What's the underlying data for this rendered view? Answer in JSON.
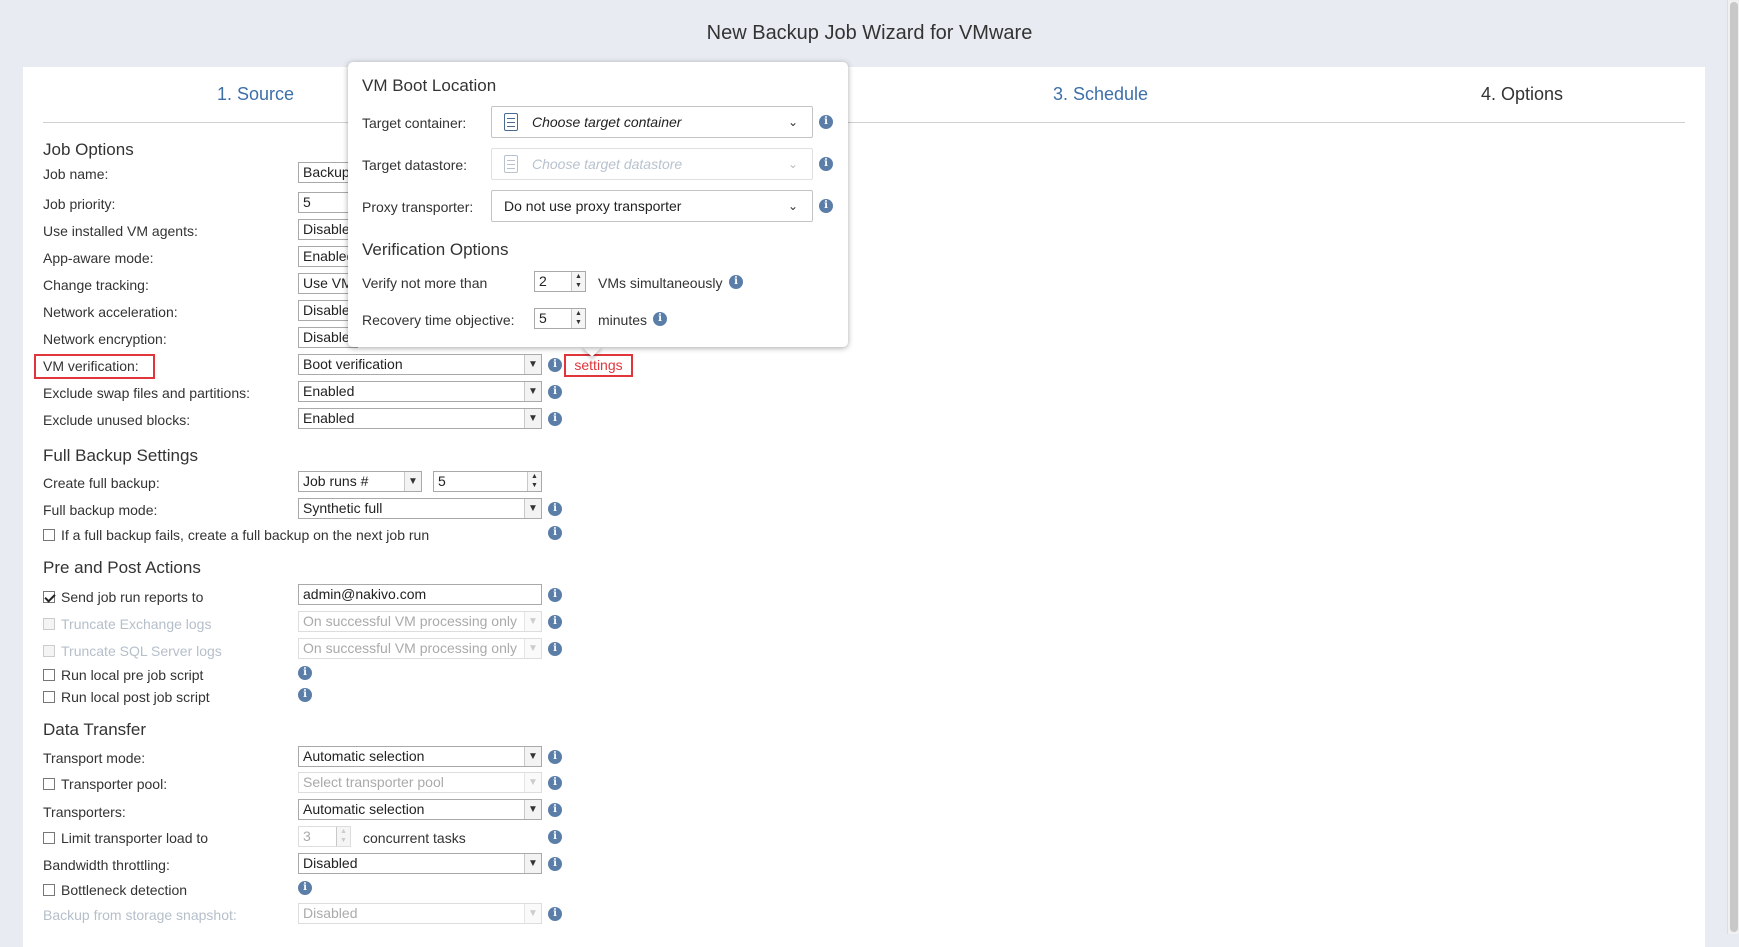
{
  "page_title": "New Backup Job Wizard for VMware",
  "steps": [
    {
      "label": "1. Source"
    },
    {
      "label": "3. Schedule"
    },
    {
      "label": "4. Options"
    }
  ],
  "job_options": {
    "title": "Job Options",
    "job_name": {
      "label": "Job name:",
      "value": "Backup"
    },
    "job_priority": {
      "label": "Job priority:",
      "value": "5"
    },
    "installed_vm_agents": {
      "label": "Use installed VM agents:",
      "value": "Disable"
    },
    "app_aware_mode": {
      "label": "App-aware mode:",
      "value": "Enabled"
    },
    "change_tracking": {
      "label": "Change tracking:",
      "value": "Use VM"
    },
    "network_acceleration": {
      "label": "Network acceleration:",
      "value": "Disable"
    },
    "network_encryption": {
      "label": "Network encryption:",
      "value": "Disable"
    },
    "vm_verification": {
      "label": "VM verification:",
      "value": "Boot verification",
      "settings_label": "settings"
    },
    "exclude_swap": {
      "label": "Exclude swap files and partitions:",
      "value": "Enabled"
    },
    "exclude_unused": {
      "label": "Exclude unused blocks:",
      "value": "Enabled"
    }
  },
  "full_backup": {
    "title": "Full Backup Settings",
    "create_full": {
      "label": "Create full backup:",
      "value": "Job runs #",
      "count": "5"
    },
    "mode": {
      "label": "Full backup mode:",
      "value": "Synthetic full"
    },
    "retry_label": "If a full backup fails, create a full backup on the next job run"
  },
  "pre_post": {
    "title": "Pre and Post Actions",
    "send_reports": {
      "label": "Send job run reports to",
      "value": "admin@nakivo.com"
    },
    "truncate_exchange": {
      "label": "Truncate Exchange logs",
      "value": "On successful VM processing only"
    },
    "truncate_sql": {
      "label": "Truncate SQL Server logs",
      "value": "On successful VM processing only"
    },
    "pre_script": "Run local pre job script",
    "post_script": "Run local post job script"
  },
  "data_transfer": {
    "title": "Data Transfer",
    "transport_mode": {
      "label": "Transport mode:",
      "value": "Automatic selection"
    },
    "transporter_pool": {
      "label": "Transporter pool:",
      "value": "Select transporter pool"
    },
    "transporters": {
      "label": "Transporters:",
      "value": "Automatic selection"
    },
    "limit_load": {
      "label": "Limit transporter load to",
      "value": "3",
      "suffix": "concurrent tasks"
    },
    "bandwidth": {
      "label": "Bandwidth throttling:",
      "value": "Disabled"
    },
    "bottleneck": "Bottleneck detection",
    "storage_snapshot": {
      "label": "Backup from storage snapshot:",
      "value": "Disabled"
    }
  },
  "popup": {
    "boot_title": "VM Boot Location",
    "target_container": {
      "label": "Target container:",
      "placeholder": "Choose target container"
    },
    "target_datastore": {
      "label": "Target datastore:",
      "placeholder": "Choose target datastore"
    },
    "proxy_transporter": {
      "label": "Proxy transporter:",
      "value": "Do not use proxy transporter"
    },
    "verification_title": "Verification Options",
    "verify_limit": {
      "label": "Verify not more than",
      "value": "2",
      "suffix": "VMs simultaneously"
    },
    "rto": {
      "label": "Recovery time objective:",
      "value": "5",
      "suffix": "minutes"
    }
  },
  "colors": {
    "highlight": "#e0353b",
    "link": "#3d6fa8",
    "info": "#5a7ea8"
  }
}
